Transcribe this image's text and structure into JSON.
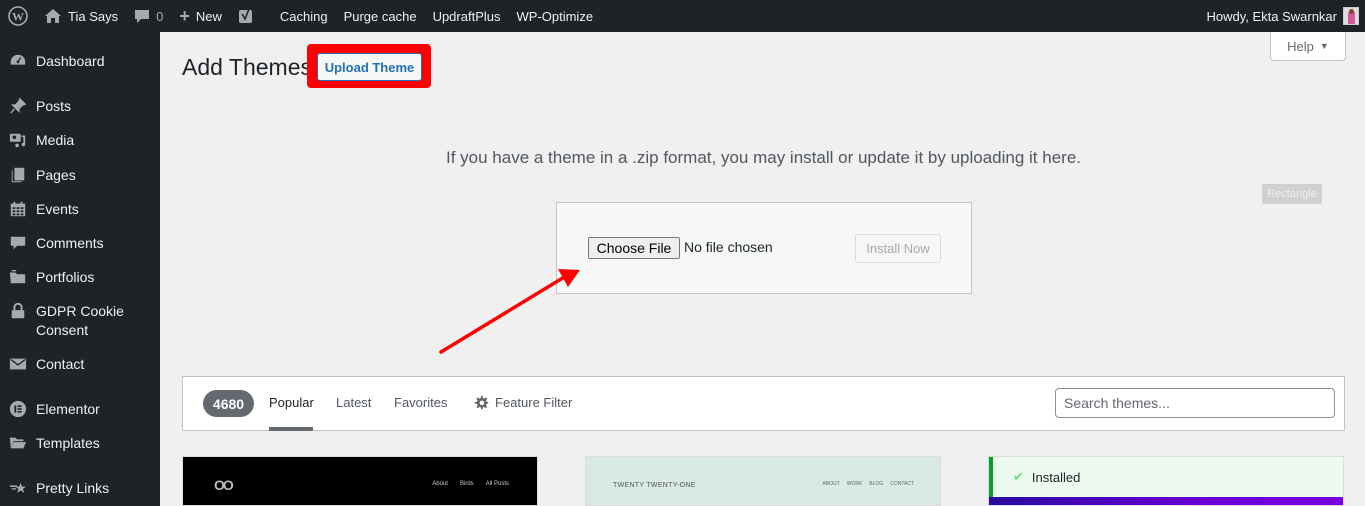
{
  "adminbar": {
    "site_name": "Tia Says",
    "comments_count": "0",
    "new_label": "New",
    "links": [
      "Caching",
      "Purge cache",
      "UpdraftPlus",
      "WP-Optimize"
    ],
    "greeting": "Howdy, Ekta Swarnkar"
  },
  "sidebar": {
    "items": [
      {
        "label": "Dashboard",
        "icon": "dashboard-icon"
      },
      {
        "label": "Posts",
        "icon": "pin-icon"
      },
      {
        "label": "Media",
        "icon": "media-icon"
      },
      {
        "label": "Pages",
        "icon": "pages-icon"
      },
      {
        "label": "Events",
        "icon": "calendar-icon"
      },
      {
        "label": "Comments",
        "icon": "comment-icon"
      },
      {
        "label": "Portfolios",
        "icon": "portfolio-icon"
      },
      {
        "label": "GDPR Cookie Consent",
        "icon": "lock-icon"
      },
      {
        "label": "Contact",
        "icon": "mail-icon"
      },
      {
        "label": "Elementor",
        "icon": "elementor-icon"
      },
      {
        "label": "Templates",
        "icon": "folder-icon"
      },
      {
        "label": "Pretty Links",
        "icon": "star-link-icon"
      }
    ]
  },
  "header": {
    "title": "Add Themes",
    "upload_button": "Upload Theme",
    "help_label": "Help"
  },
  "upload": {
    "description": "If you have a theme in a .zip format, you may install or update it by uploading it here.",
    "choose_file_label": "Choose File",
    "no_file_text": "No file chosen",
    "install_button": "Install Now",
    "annotation_label": "Rectangle"
  },
  "filter": {
    "count": "4680",
    "tabs": [
      "Popular",
      "Latest",
      "Favorites"
    ],
    "active_tab": "Popular",
    "feature_filter": "Feature Filter",
    "search_placeholder": "Search themes..."
  },
  "themes": [
    {
      "preview_nav": [
        "About",
        "Birds",
        "All Posts"
      ],
      "logo": "OO"
    },
    {
      "preview_title": "TWENTY TWENTY-ONE",
      "preview_nav": [
        "ABOUT",
        "WORK",
        "BLOG",
        "CONTACT"
      ]
    },
    {
      "status": "Installed"
    }
  ],
  "colors": {
    "adminbar_bg": "#1d2327",
    "accent": "#2271b1",
    "highlight": "#ff0000",
    "installed_border": "#00a32a"
  }
}
